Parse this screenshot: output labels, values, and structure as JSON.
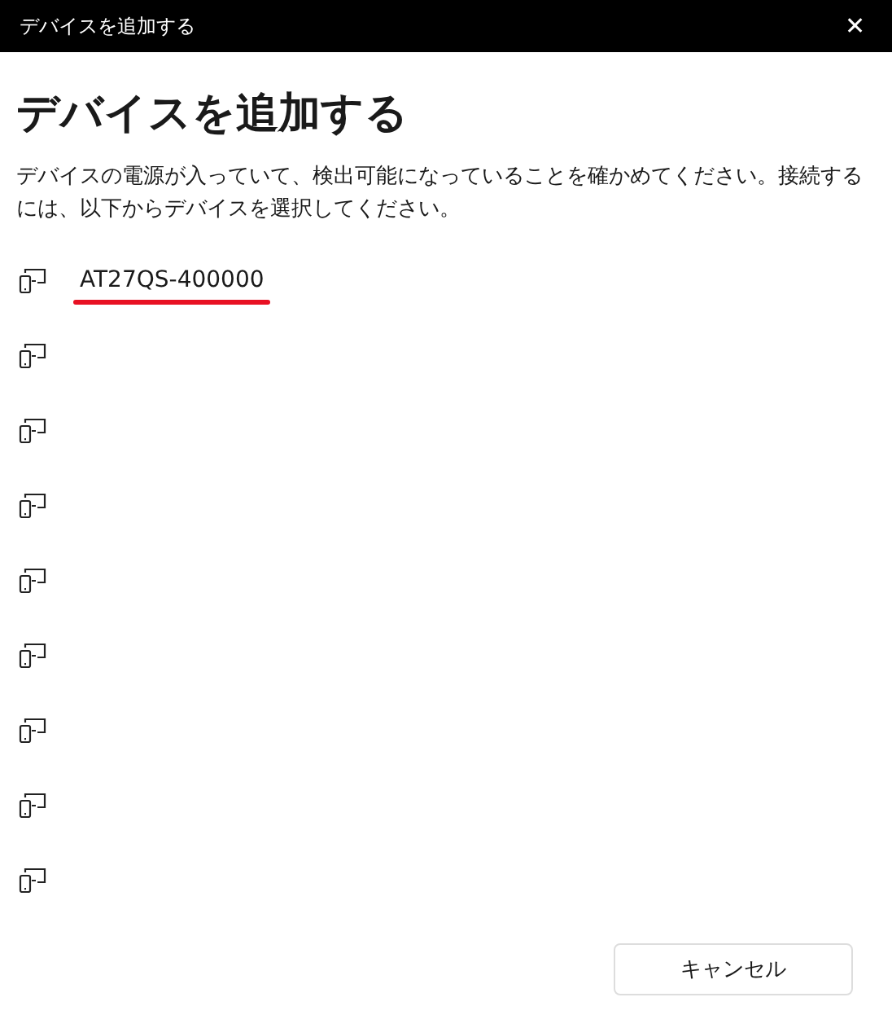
{
  "window": {
    "title": "デバイスを追加する",
    "close": "✕"
  },
  "heading": "デバイスを追加する",
  "description": "デバイスの電源が入っていて、検出可能になっていることを確かめてください。接続するには、以下からデバイスを選択してください。",
  "devices": [
    {
      "kind": "named",
      "name": "AT27QS-400000",
      "underlined": true
    },
    {
      "kind": "unnamed"
    },
    {
      "kind": "unnamed"
    },
    {
      "kind": "unnamed"
    },
    {
      "kind": "unnamed"
    },
    {
      "kind": "unnamed"
    },
    {
      "kind": "unnamed"
    },
    {
      "kind": "unnamed"
    },
    {
      "kind": "unnamed"
    }
  ],
  "buttons": [
    "キャンセル"
  ]
}
